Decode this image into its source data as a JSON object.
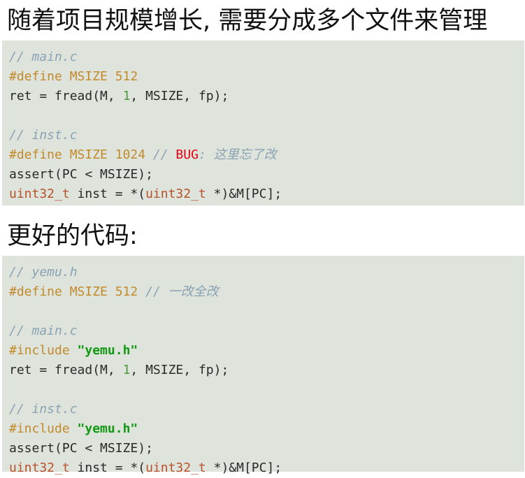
{
  "title": "随着项目规模增长, 需要分成多个文件来管理",
  "subtitle": "更好的代码:",
  "block1": {
    "main_comment": "// main.c",
    "main_define_kw": "#define",
    "main_define_rest": " MSIZE 512",
    "main_fread_pre": "ret = fread(M, ",
    "main_fread_num": "1",
    "main_fread_post": ", MSIZE, fp);",
    "inst_comment": "// inst.c",
    "inst_define_kw": "#define",
    "inst_define_rest": " MSIZE 1024 ",
    "inst_bug_slashes": "// ",
    "inst_bug_word": "BUG",
    "inst_bug_rest": ": 这里忘了改",
    "assert_line": "assert(PC < MSIZE);",
    "uint_type1": "uint32_t",
    "uint_mid": " inst = *(",
    "uint_type2": "uint32_t",
    "uint_end": " *)&M[PC];"
  },
  "block2": {
    "yemu_comment": "// yemu.h",
    "yemu_define_kw": "#define",
    "yemu_define_rest": " MSIZE 512 ",
    "yemu_define_comment": "// 一改全改",
    "main_comment": "// main.c",
    "main_include_kw": "#include ",
    "main_include_str": "\"yemu.h\"",
    "main_fread_pre": "ret = fread(M, ",
    "main_fread_num": "1",
    "main_fread_post": ", MSIZE, fp);",
    "inst_comment": "// inst.c",
    "inst_include_kw": "#include ",
    "inst_include_str": "\"yemu.h\"",
    "assert_line": "assert(PC < MSIZE);",
    "uint_type1": "uint32_t",
    "uint_mid": " inst = *(",
    "uint_type2": "uint32_t",
    "uint_end": " *)&M[PC];"
  },
  "colors": {
    "code_background": "#dee3dc",
    "comment": "#8aa3b3",
    "preprocessor": "#c28a2b",
    "number": "#4d9a3f",
    "type": "#b8522a",
    "string": "#119911",
    "bug": "#e60012"
  }
}
